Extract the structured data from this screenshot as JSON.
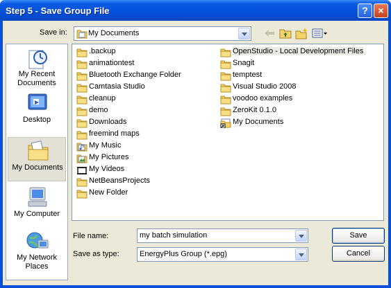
{
  "window": {
    "title": "Step 5 - Save Group File"
  },
  "titlebar": {
    "help_label": "?",
    "close_label": "×"
  },
  "save_in": {
    "label": "Save in:",
    "value": "My Documents"
  },
  "places": [
    {
      "label": "My Recent Documents",
      "icon": "recent-documents-icon"
    },
    {
      "label": "Desktop",
      "icon": "desktop-icon"
    },
    {
      "label": "My Documents",
      "icon": "my-documents-icon",
      "selected": true
    },
    {
      "label": "My Computer",
      "icon": "computer-icon"
    },
    {
      "label": "My Network Places",
      "icon": "network-icon"
    }
  ],
  "files": [
    {
      "name": ".backup",
      "type": "folder"
    },
    {
      "name": "animationtest",
      "type": "folder"
    },
    {
      "name": "Bluetooth Exchange Folder",
      "type": "folder"
    },
    {
      "name": "Camtasia Studio",
      "type": "folder"
    },
    {
      "name": "cleanup",
      "type": "folder"
    },
    {
      "name": "demo",
      "type": "folder"
    },
    {
      "name": "Downloads",
      "type": "folder"
    },
    {
      "name": "freemind maps",
      "type": "folder"
    },
    {
      "name": "My Music",
      "type": "music"
    },
    {
      "name": "My Pictures",
      "type": "pictures"
    },
    {
      "name": "My Videos",
      "type": "videos"
    },
    {
      "name": "NetBeansProjects",
      "type": "folder"
    },
    {
      "name": "New Folder",
      "type": "folder"
    },
    {
      "name": "OpenStudio - Local Development Files",
      "type": "folder",
      "highlighted": true
    },
    {
      "name": "Snagit",
      "type": "folder"
    },
    {
      "name": "temptest",
      "type": "folder"
    },
    {
      "name": "Visual Studio 2008",
      "type": "folder"
    },
    {
      "name": "voodoo examples",
      "type": "folder"
    },
    {
      "name": "ZeroKit 0.1.0",
      "type": "folder"
    },
    {
      "name": "My Documents",
      "type": "shortcut"
    }
  ],
  "file_name": {
    "label": "File name:",
    "value": "my batch simulation"
  },
  "save_as_type": {
    "label": "Save as type:",
    "value": "EnergyPlus Group (*.epg)"
  },
  "buttons": {
    "save": "Save",
    "cancel": "Cancel"
  },
  "colors": {
    "titlebar": "#0550d8",
    "dialog_bg": "#ece9d8",
    "folder": "#f5d36a"
  }
}
